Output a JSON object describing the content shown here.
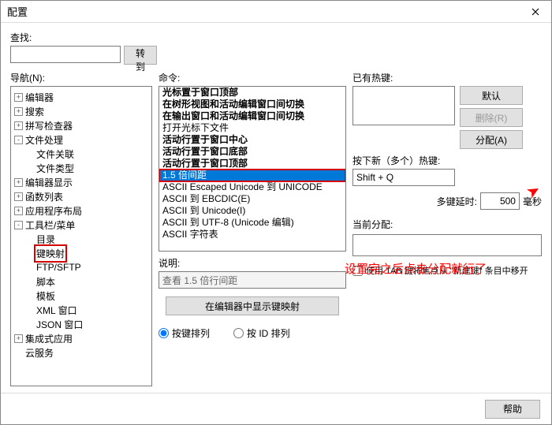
{
  "window": {
    "title": "配置"
  },
  "search": {
    "label": "查找:",
    "value": "",
    "go_btn": "转到"
  },
  "nav": {
    "label": "导航(N):",
    "items": [
      {
        "exp": "+",
        "txt": "编辑器",
        "lvl": 0
      },
      {
        "exp": "+",
        "txt": "搜索",
        "lvl": 0
      },
      {
        "exp": "+",
        "txt": "拼写检查器",
        "lvl": 0
      },
      {
        "exp": "-",
        "txt": "文件处理",
        "lvl": 0
      },
      {
        "exp": "",
        "txt": "文件关联",
        "lvl": 1
      },
      {
        "exp": "",
        "txt": "文件类型",
        "lvl": 1
      },
      {
        "exp": "+",
        "txt": "编辑器显示",
        "lvl": 0
      },
      {
        "exp": "+",
        "txt": "函数列表",
        "lvl": 0
      },
      {
        "exp": "+",
        "txt": "应用程序布局",
        "lvl": 0
      },
      {
        "exp": "-",
        "txt": "工具栏/菜单",
        "lvl": 0
      },
      {
        "exp": "",
        "txt": "目录",
        "lvl": 1
      },
      {
        "exp": "",
        "txt": "键映射",
        "lvl": 1,
        "sel": true
      },
      {
        "exp": "",
        "txt": "FTP/SFTP",
        "lvl": 1
      },
      {
        "exp": "",
        "txt": "脚本",
        "lvl": 1
      },
      {
        "exp": "",
        "txt": "模板",
        "lvl": 1
      },
      {
        "exp": "",
        "txt": "XML 窗口",
        "lvl": 1
      },
      {
        "exp": "",
        "txt": "JSON 窗口",
        "lvl": 1
      },
      {
        "exp": "+",
        "txt": "集成式应用",
        "lvl": 0
      },
      {
        "exp": "",
        "txt": "云服务",
        "lvl": 0
      }
    ]
  },
  "commands": {
    "label": "命令:",
    "items": [
      {
        "t": "光标置于窗口顶部",
        "b": true
      },
      {
        "t": "在树形视图和活动编辑窗口间切换",
        "b": true
      },
      {
        "t": "在输出窗口和活动编辑窗口间切换",
        "b": true
      },
      {
        "t": "打开光标下文件",
        "b": false
      },
      {
        "t": "活动行置于窗口中心",
        "b": true
      },
      {
        "t": "活动行置于窗口底部",
        "b": true
      },
      {
        "t": "活动行置于窗口顶部",
        "b": true
      },
      {
        "t": "1.5 倍间距",
        "b": false,
        "sel": true
      },
      {
        "t": "ASCII Escaped Unicode 到 UNICODE",
        "b": false
      },
      {
        "t": "ASCII 到 EBCDIC(E)",
        "b": false
      },
      {
        "t": "ASCII 到 Unicode(I)",
        "b": false
      },
      {
        "t": "ASCII 到 UTF-8 (Unicode 编辑)",
        "b": false
      },
      {
        "t": "ASCII 字符表",
        "b": false
      }
    ]
  },
  "desc": {
    "label": "说明:",
    "value": "查看 1.5 倍行间距"
  },
  "show_btn": "在编辑器中显示键映射",
  "radios": {
    "by_key": "按键排列",
    "by_id": "按 ID 排列"
  },
  "right": {
    "existing_label": "已有热键:",
    "default_btn": "默认",
    "delete_btn": "删除(R)",
    "assign_btn": "分配(A)",
    "press_label": "按下新（多个）热键:",
    "press_value": "Shift + Q",
    "delay_label": "多键延时:",
    "delay_value": "500",
    "delay_unit": "毫秒",
    "current_label": "当前分配:",
    "tab_check": "使用 TAB 键将焦点从 \"新建键\" 条目中移开"
  },
  "annotation": "设置完之后点击分配就行了",
  "footer": {
    "help": "帮助"
  }
}
